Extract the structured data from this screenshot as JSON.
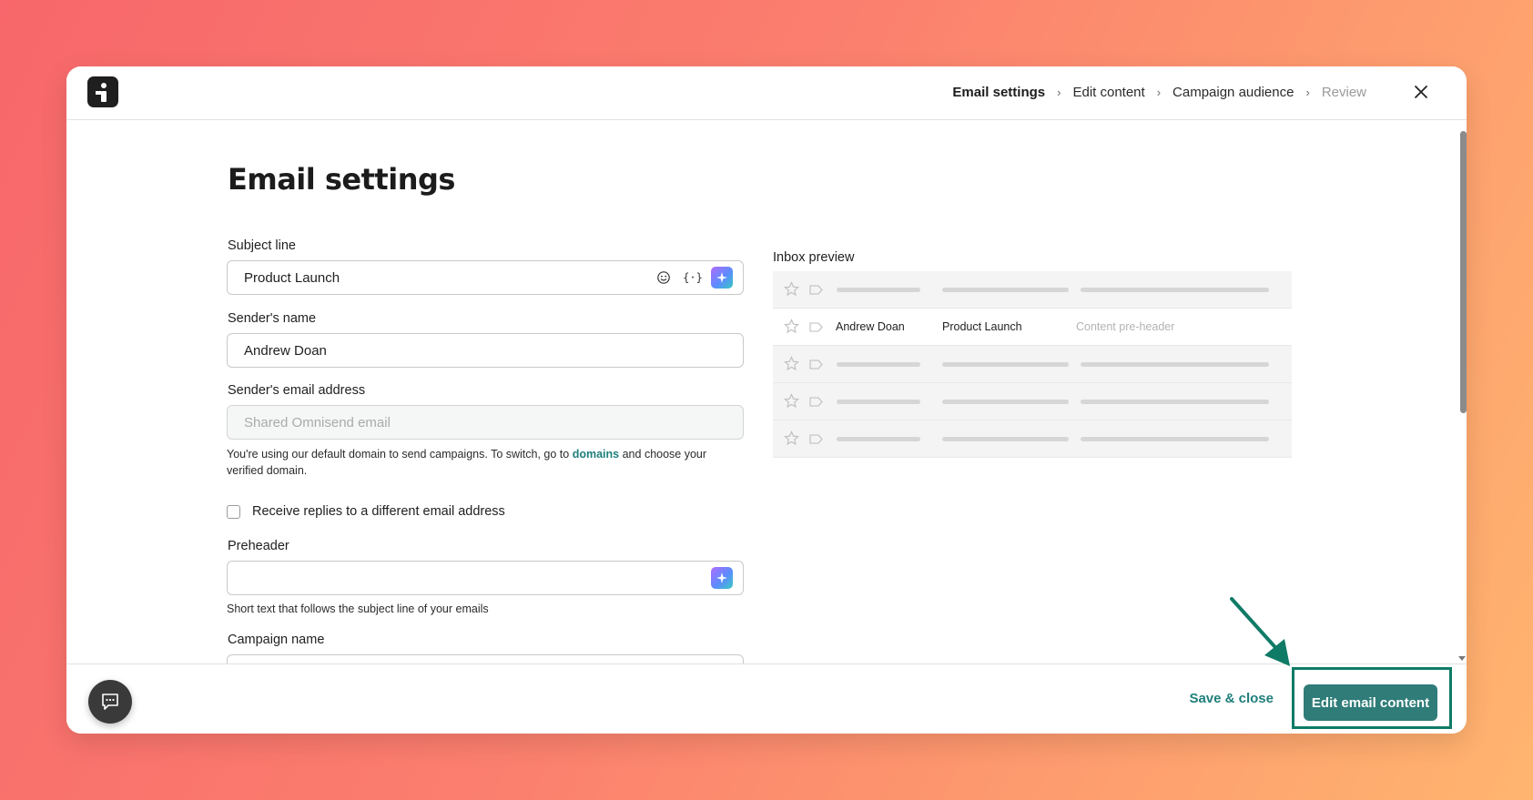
{
  "app": {
    "logo_icon": "omnisend-logo-icon"
  },
  "breadcrumbs": [
    {
      "label": "Email settings",
      "state": "active"
    },
    {
      "label": "Edit content",
      "state": "default"
    },
    {
      "label": "Campaign audience",
      "state": "default"
    },
    {
      "label": "Review",
      "state": "disabled"
    }
  ],
  "page": {
    "title": "Email settings"
  },
  "form": {
    "subject": {
      "label": "Subject line",
      "value": "Product Launch"
    },
    "sender_name": {
      "label": "Sender's name",
      "value": "Andrew Doan"
    },
    "sender_email": {
      "label": "Sender's email address",
      "placeholder": "Shared Omnisend email",
      "helper_before": "You're using our default domain to send campaigns. To switch, go to",
      "helper_link": "domains",
      "helper_after": "and choose your verified domain."
    },
    "reply_checkbox": {
      "label": "Receive replies to a different email address",
      "checked": false
    },
    "preheader": {
      "label": "Preheader",
      "value": "",
      "helper": "Short text that follows the subject line of your emails"
    },
    "campaign_name": {
      "label": "Campaign name"
    }
  },
  "inbox_preview": {
    "title": "Inbox preview",
    "sender": "Andrew Doan",
    "subject": "Product Launch",
    "preheader_placeholder": "Content pre-header"
  },
  "footer": {
    "save_close_label": "Save & close",
    "primary_label": "Edit email content"
  },
  "colors": {
    "accent": "#2f7c79",
    "annotation": "#0f7b66"
  }
}
